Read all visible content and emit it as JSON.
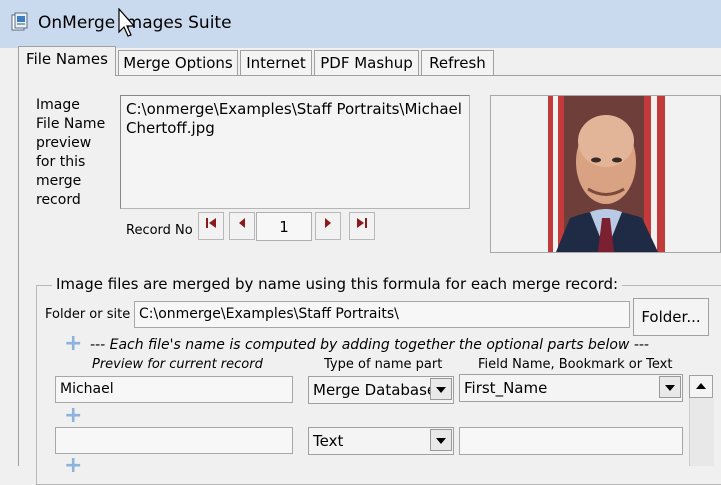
{
  "window": {
    "title": "OnMerge Images Suite"
  },
  "tabs": [
    {
      "label": "File Names"
    },
    {
      "label": "Merge Options"
    },
    {
      "label": "Internet"
    },
    {
      "label": "PDF Mashup"
    },
    {
      "label": "Refresh"
    }
  ],
  "preview": {
    "label_lines": [
      "Image",
      "File Name",
      "preview",
      "for this",
      "merge",
      "record"
    ],
    "value": "C:\\onmerge\\Examples\\Staff Portraits\\Michael Chertoff.jpg"
  },
  "navigation": {
    "record_label": "Record No",
    "record_number": "1"
  },
  "formula": {
    "legend": "Image files are merged by name using this formula for each merge record:",
    "folder_label": "Folder or site",
    "folder_value": "C:\\onmerge\\Examples\\Staff Portraits\\",
    "folder_button": "Folder...",
    "hint": "--- Each file's name is computed by adding together the optional parts below ---",
    "columns": {
      "preview": "Preview for current record",
      "type": "Type of name part",
      "field": "Field Name, Bookmark or Text"
    },
    "rows": [
      {
        "preview": "Michael",
        "type": "Merge Database",
        "field": "First_Name"
      },
      {
        "preview": "",
        "type": "Text",
        "field": ""
      }
    ]
  },
  "colors": {
    "titlebar": "#c9d9ee",
    "plus": "#8db3dc",
    "nav_arrow": "#8b1a1a"
  }
}
